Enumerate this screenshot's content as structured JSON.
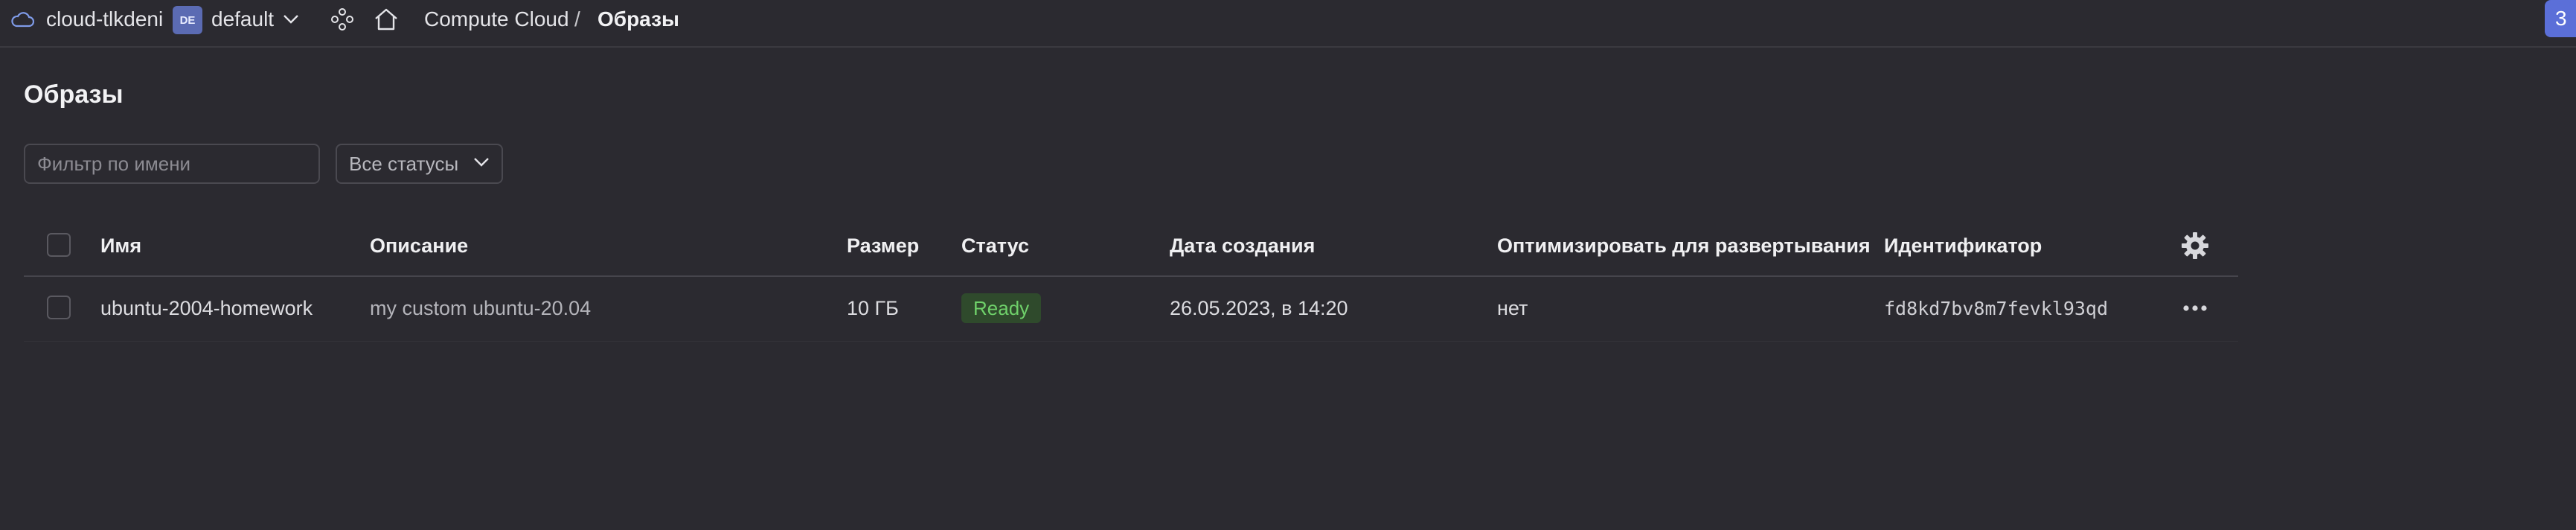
{
  "header": {
    "cloud_name": "cloud-tlkdeni",
    "folder_badge": "DE",
    "folder_name": "default",
    "breadcrumb_service": "Compute Cloud",
    "breadcrumb_separator": "/",
    "breadcrumb_current": "Образы",
    "corner_button_label": "3"
  },
  "page": {
    "title": "Образы",
    "filter_placeholder": "Фильтр по имени",
    "status_filter_label": "Все статусы"
  },
  "table": {
    "columns": {
      "name": "Имя",
      "description": "Описание",
      "size": "Размер",
      "status": "Статус",
      "created": "Дата создания",
      "optimize": "Оптимизировать для развертывания",
      "id": "Идентификатор"
    },
    "rows": [
      {
        "name": "ubuntu-2004-homework",
        "description": "my custom ubuntu-20.04",
        "size": "10 ГБ",
        "status": "Ready",
        "created": "26.05.2023, в 14:20",
        "optimize": "нет",
        "id": "fd8kd7bv8m7fevkl93qd"
      }
    ]
  },
  "colors": {
    "background": "#2b2a30",
    "accent": "#5b6fd8",
    "status_ready_text": "#6fd06a",
    "status_ready_bg": "#2f4a2c"
  },
  "icons": [
    "cloud-icon",
    "chevron-down-icon",
    "nodes-icon",
    "home-icon",
    "gear-icon",
    "more-icon"
  ]
}
